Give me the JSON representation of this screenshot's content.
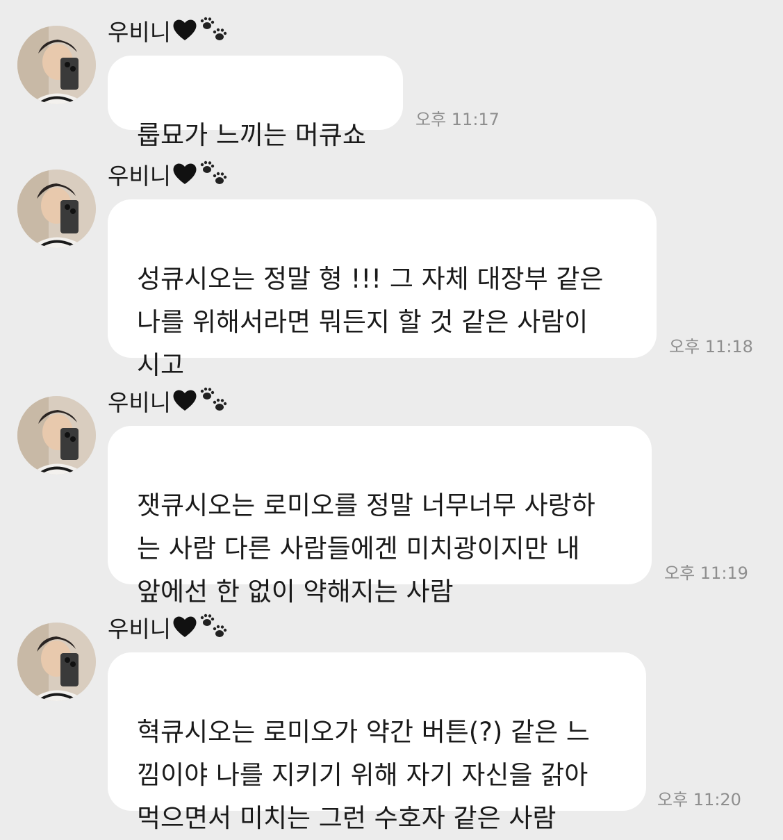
{
  "messages": [
    {
      "sender": "우비니",
      "heart": "🖤",
      "text": "룹묘가 느끼는 머큐쇼",
      "time": "오후 11:17"
    },
    {
      "sender": "우비니",
      "heart": "🖤",
      "text": "성큐시오는 정말 형 !!! 그 자체 대장부 같은\n나를 위해서라면 뭐든지 할 것 같은 사람이\n시고",
      "time": "오후 11:18"
    },
    {
      "sender": "우비니",
      "heart": "🖤",
      "text": "잿큐시오는 로미오를 정말 너무너무 사랑하\n는 사람 다른 사람들에겐 미치광이지만 내\n앞에선 한 없이 약해지는 사람",
      "time": "오후 11:19"
    },
    {
      "sender": "우비니",
      "heart": "🖤",
      "text": "혁큐시오는 로미오가 약간 버튼(?) 같은 느\n낌이야 나를 지키기 위해 자기 자신을 갉아\n먹으면서 미치는 그런 수호자 같은 사람",
      "time": "오후 11:20"
    }
  ],
  "icons": {
    "heart": "black-heart-icon",
    "paw": "paw-prints-icon",
    "avatar": "profile-photo-avatar"
  },
  "colors": {
    "background": "#ececec",
    "bubble": "#ffffff",
    "text": "#1a1a1a",
    "time": "#8e8e8e"
  }
}
